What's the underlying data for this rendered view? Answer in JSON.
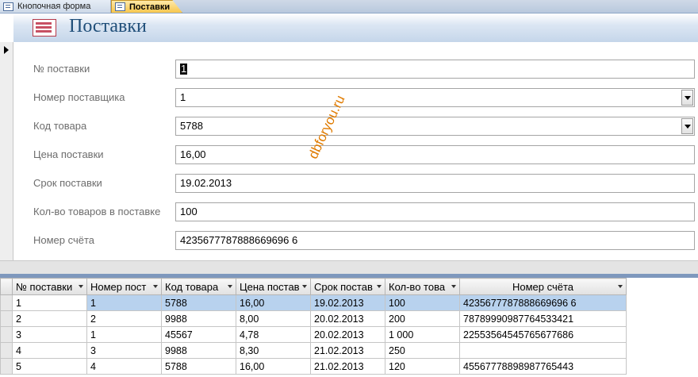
{
  "tabs": [
    {
      "label": "Кнопочная форма",
      "active": false
    },
    {
      "label": "Поставки",
      "active": true
    }
  ],
  "form": {
    "title": "Поставки",
    "fields": [
      {
        "label": "№ поставки",
        "value": "1",
        "type": "text"
      },
      {
        "label": "Номер поставщика",
        "value": "1",
        "type": "combo"
      },
      {
        "label": "Код товара",
        "value": "5788",
        "type": "combo"
      },
      {
        "label": "Цена поставки",
        "value": "16,00",
        "type": "text"
      },
      {
        "label": "Срок поставки",
        "value": "19.02.2013",
        "type": "text"
      },
      {
        "label": "Кол-во товаров в поставке",
        "value": "100",
        "type": "text"
      },
      {
        "label": "Номер счёта",
        "value": "4235677787888669696 6",
        "type": "text"
      }
    ],
    "watermark": "dbforyou.ru"
  },
  "datasheet": {
    "columns": [
      "№ поставки",
      "Номер пост",
      "Код товара",
      "Цена постав",
      "Срок постав",
      "Кол-во това",
      "Номер счёта"
    ],
    "rows": [
      [
        "1",
        "1",
        "5788",
        "16,00",
        "19.02.2013",
        "100",
        "4235677787888669696 6"
      ],
      [
        "2",
        "2",
        "9988",
        "8,00",
        "20.02.2013",
        "200",
        "78789990987764533421"
      ],
      [
        "3",
        "1",
        "45567",
        "4,78",
        "20.02.2013",
        "1 000",
        "22553564545765677686"
      ],
      [
        "4",
        "3",
        "9988",
        "8,30",
        "21.02.2013",
        "250",
        ""
      ],
      [
        "5",
        "4",
        "5788",
        "16,00",
        "21.02.2013",
        "120",
        "45567778898987765443"
      ]
    ]
  },
  "colors": {
    "accent": "#1f4e79",
    "tab_active": "#f7c64d",
    "row_selected": "#b8d2ee"
  }
}
